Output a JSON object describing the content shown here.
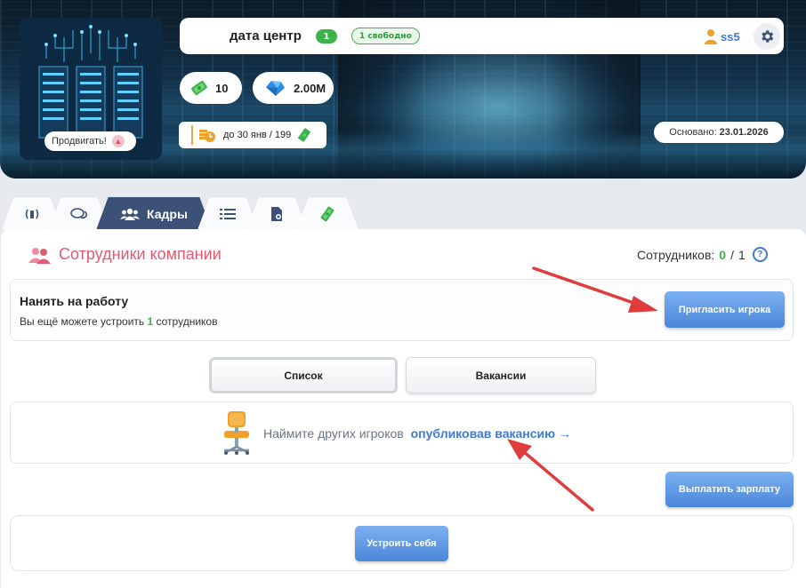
{
  "header": {
    "company_name": "дата центр",
    "level_badge": "1",
    "free_badge": "1 свободно",
    "owner_name": "ss5",
    "promote_label": "Продвигать!",
    "money_value": "10",
    "gems_value": "2.00M",
    "deadline_text": "до 30 янв / 199",
    "founded_label": "Основано:",
    "founded_date": "23.01.2026"
  },
  "tabs": [
    {
      "icon": "radio-tower-icon",
      "label": ""
    },
    {
      "icon": "chat-icon",
      "label": ""
    },
    {
      "icon": "users-icon",
      "label": "Кадры"
    },
    {
      "icon": "list-icon",
      "label": ""
    },
    {
      "icon": "document-icon",
      "label": ""
    },
    {
      "icon": "money-icon",
      "label": ""
    }
  ],
  "staff": {
    "title": "Сотрудники компании",
    "count_label": "Сотрудников:",
    "count_current": "0",
    "count_separator": "/",
    "count_max": "1",
    "help": "?"
  },
  "hire": {
    "title": "Нанять на работу",
    "subtitle_before": "Вы ещё можете устроить",
    "subtitle_number": "1",
    "subtitle_after": "сотрудников",
    "invite_label": "Пригласить игрока"
  },
  "segments": {
    "list_label": "Список",
    "vacancies_label": "Вакансии"
  },
  "hint": {
    "text": "Наймите других игроков",
    "link": "опубликовав вакансию →"
  },
  "actions": {
    "pay_salary_label": "Выплатить зарплату",
    "hire_self_label": "Устроить себя"
  },
  "colors": {
    "accent_blue": "#4b86d9",
    "green": "#3db24a",
    "title_pink": "#e05a72",
    "tab_active": "#3c5078",
    "annotation_red": "#e03c3c"
  }
}
